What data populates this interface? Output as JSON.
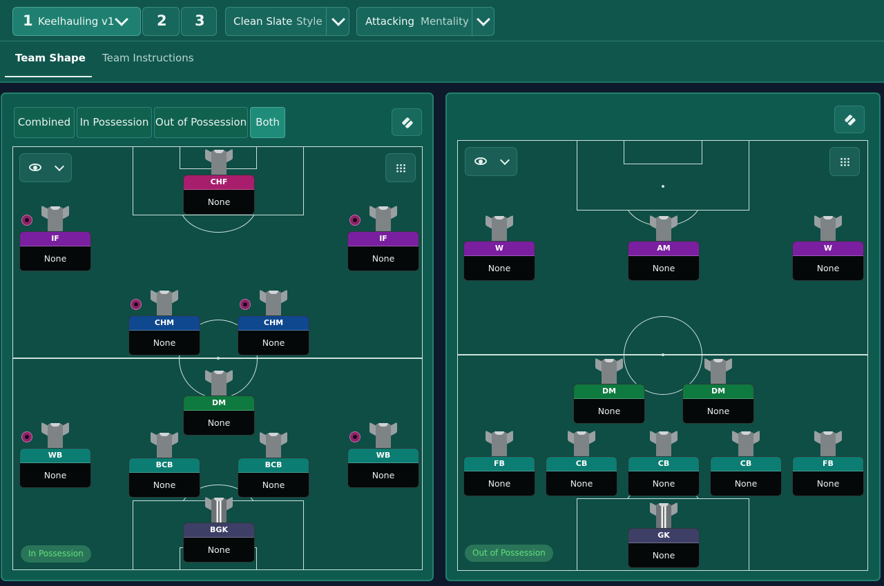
{
  "header": {
    "tactic_slot": "1",
    "tactic_name": "Keelhauling v1",
    "slot_2": "2",
    "slot_3": "3",
    "style_value": "Clean Slate",
    "style_label": "Style",
    "mentality_value": "Attacking",
    "mentality_label": "Mentality"
  },
  "tabs": [
    {
      "label": "Team Shape",
      "active": true
    },
    {
      "label": "Team Instructions",
      "active": false
    }
  ],
  "view_modes": [
    {
      "label": "Combined",
      "active": false
    },
    {
      "label": "In Possession",
      "active": false
    },
    {
      "label": "Out of Possession",
      "active": false
    },
    {
      "label": "Both",
      "active": true
    }
  ],
  "left_pitch": {
    "tag": "In Possession",
    "players": [
      {
        "role": "CHF",
        "name": "None",
        "color": "magenta",
        "badge": false
      },
      {
        "role": "IF",
        "name": "None",
        "color": "purple",
        "badge": true
      },
      {
        "role": "IF",
        "name": "None",
        "color": "purple",
        "badge": true
      },
      {
        "role": "CHM",
        "name": "None",
        "color": "blue",
        "badge": true
      },
      {
        "role": "CHM",
        "name": "None",
        "color": "blue",
        "badge": true
      },
      {
        "role": "DM",
        "name": "None",
        "color": "green",
        "badge": false
      },
      {
        "role": "WB",
        "name": "None",
        "color": "teal",
        "badge": true
      },
      {
        "role": "BCB",
        "name": "None",
        "color": "teal",
        "badge": false
      },
      {
        "role": "BCB",
        "name": "None",
        "color": "teal",
        "badge": false
      },
      {
        "role": "WB",
        "name": "None",
        "color": "teal",
        "badge": true
      },
      {
        "role": "BGK",
        "name": "None",
        "color": "slate",
        "badge": false,
        "keeper": true
      }
    ]
  },
  "right_pitch": {
    "tag": "Out of Possession",
    "players": [
      {
        "role": "W",
        "name": "None",
        "color": "purple",
        "badge": false
      },
      {
        "role": "AM",
        "name": "None",
        "color": "purple",
        "badge": false
      },
      {
        "role": "W",
        "name": "None",
        "color": "purple",
        "badge": false
      },
      {
        "role": "DM",
        "name": "None",
        "color": "green",
        "badge": false
      },
      {
        "role": "DM",
        "name": "None",
        "color": "green",
        "badge": false
      },
      {
        "role": "FB",
        "name": "None",
        "color": "teal",
        "badge": false
      },
      {
        "role": "CB",
        "name": "None",
        "color": "teal",
        "badge": false
      },
      {
        "role": "CB",
        "name": "None",
        "color": "teal",
        "badge": false
      },
      {
        "role": "CB",
        "name": "None",
        "color": "teal",
        "badge": false
      },
      {
        "role": "FB",
        "name": "None",
        "color": "teal",
        "badge": false
      },
      {
        "role": "GK",
        "name": "None",
        "color": "slate",
        "badge": false,
        "keeper": true
      }
    ]
  },
  "icons": {
    "swap": "swap-icon",
    "visibility": "eye-icon",
    "grid": "grid-icon",
    "dropdown": "chevron-down-icon"
  }
}
